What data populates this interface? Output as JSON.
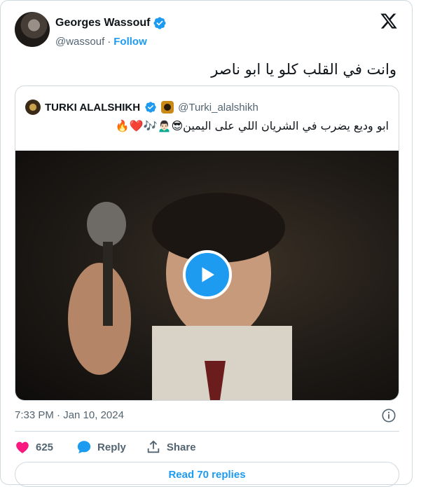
{
  "author": {
    "name": "Georges Wassouf",
    "handle": "@wassouf",
    "separator": "·",
    "follow_label": "Follow"
  },
  "tweet": {
    "text": "وانت في القلب كلو يا ابو ناصر",
    "time": "7:33 PM · Jan 10, 2024"
  },
  "quote": {
    "name": "TURKI ALALSHIKH",
    "handle": "@Turki_alalshikh",
    "text": "ابو وديع يضرب في الشريان اللي على اليمين😎🙍🏻‍♂️🎶❤️🔥"
  },
  "actions": {
    "like_count": "625",
    "reply_label": "Reply",
    "share_label": "Share"
  },
  "footer": {
    "read_replies_label": "Read 70 replies"
  },
  "colors": {
    "accent": "#1d9bf0",
    "like": "#f91880",
    "muted": "#536471",
    "border": "#cfd9de"
  },
  "icons": [
    "x-logo-icon",
    "verified-badge-icon",
    "play-icon",
    "info-icon",
    "heart-icon",
    "reply-bubble-icon",
    "share-icon"
  ]
}
